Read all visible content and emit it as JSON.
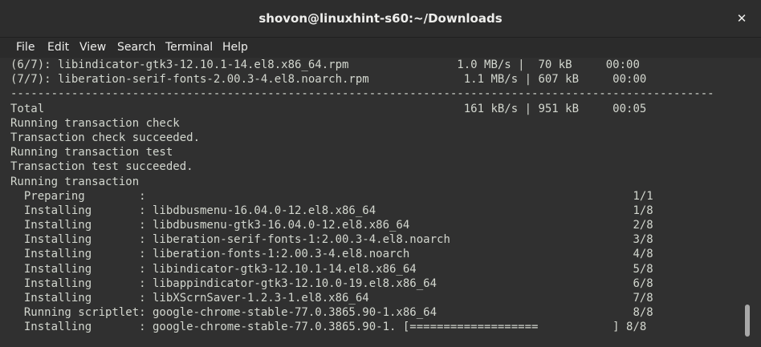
{
  "window": {
    "title": "shovon@linuxhint-s60:~/Downloads",
    "close_glyph": "✕"
  },
  "menu": {
    "items": [
      "File",
      "Edit",
      "View",
      "Search",
      "Terminal",
      "Help"
    ]
  },
  "terminal": {
    "lines": [
      "(6/7): libindicator-gtk3-12.10.1-14.el8.x86_64.rpm                1.0 MB/s |  70 kB     00:00",
      "(7/7): liberation-serif-fonts-2.00.3-4.el8.noarch.rpm              1.1 MB/s | 607 kB     00:00",
      "--------------------------------------------------------------------------------------------------------",
      "Total                                                              161 kB/s | 951 kB     00:05",
      "Running transaction check",
      "Transaction check succeeded.",
      "Running transaction test",
      "Transaction test succeeded.",
      "Running transaction",
      "  Preparing        :                                                                        1/1",
      "  Installing       : libdbusmenu-16.04.0-12.el8.x86_64                                      1/8",
      "  Installing       : libdbusmenu-gtk3-16.04.0-12.el8.x86_64                                 2/8",
      "  Installing       : liberation-serif-fonts-1:2.00.3-4.el8.noarch                           3/8",
      "  Installing       : liberation-fonts-1:2.00.3-4.el8.noarch                                 4/8",
      "  Installing       : libindicator-gtk3-12.10.1-14.el8.x86_64                                5/8",
      "  Installing       : libappindicator-gtk3-12.10.0-19.el8.x86_64                             6/8",
      "  Installing       : libXScrnSaver-1.2.3-1.el8.x86_64                                       7/8",
      "  Running scriptlet: google-chrome-stable-77.0.3865.90-1.x86_64                             8/8",
      "  Installing       : google-chrome-stable-77.0.3865.90-1. [===================           ] 8/8"
    ]
  },
  "scrollbar": {
    "position_fraction": 0.97
  }
}
